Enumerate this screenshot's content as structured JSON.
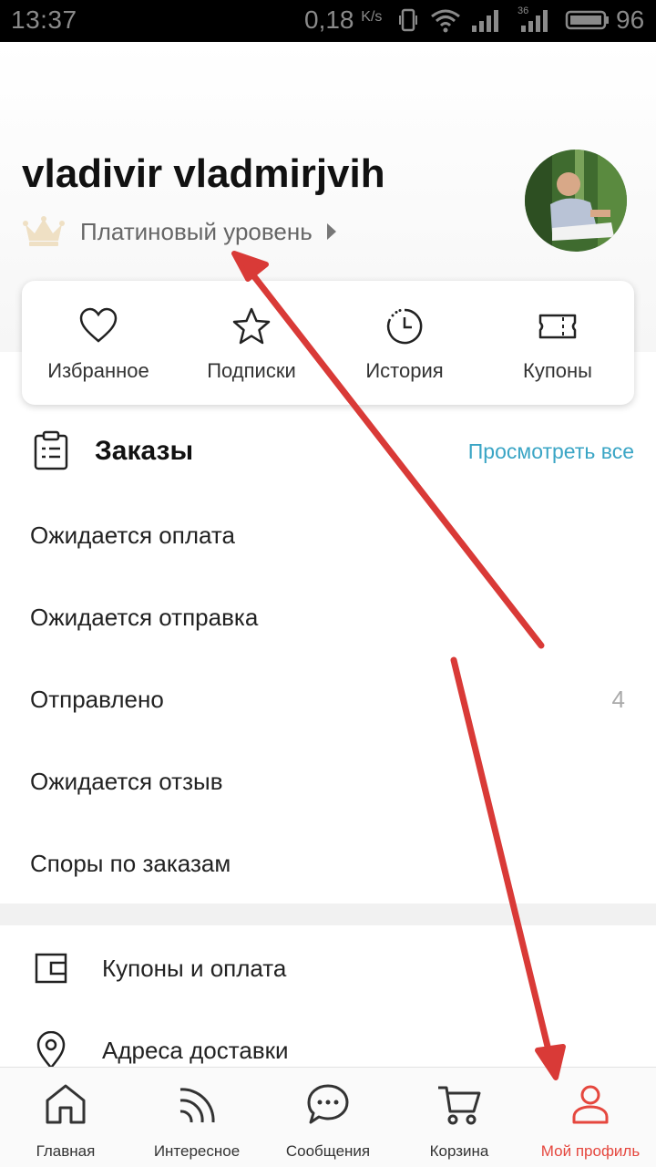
{
  "status_bar": {
    "time": "13:37",
    "speed": "0,18",
    "speed_unit": "K/s",
    "network": "36",
    "battery": "96"
  },
  "profile": {
    "name": "vladivir vladmirjvih",
    "level": "Платиновый уровень"
  },
  "quick_actions": [
    {
      "label": "Избранное",
      "icon": "heart-icon"
    },
    {
      "label": "Подписки",
      "icon": "star-icon"
    },
    {
      "label": "История",
      "icon": "history-icon"
    },
    {
      "label": "Купоны",
      "icon": "coupon-icon"
    }
  ],
  "orders": {
    "title": "Заказы",
    "view_all": "Просмотреть все",
    "items": [
      {
        "label": "Ожидается оплата",
        "count": ""
      },
      {
        "label": "Ожидается отправка",
        "count": ""
      },
      {
        "label": "Отправлено",
        "count": "4"
      },
      {
        "label": "Ожидается отзыв",
        "count": ""
      },
      {
        "label": "Споры по заказам",
        "count": ""
      }
    ]
  },
  "menu": [
    {
      "label": "Купоны и оплата",
      "icon": "wallet-icon"
    },
    {
      "label": "Адреса доставки",
      "icon": "location-pin-icon"
    }
  ],
  "bottom_nav": [
    {
      "label": "Главная",
      "icon": "home-icon"
    },
    {
      "label": "Интересное",
      "icon": "feed-icon"
    },
    {
      "label": "Сообщения",
      "icon": "chat-icon"
    },
    {
      "label": "Корзина",
      "icon": "cart-icon"
    },
    {
      "label": "Мой профиль",
      "icon": "profile-icon",
      "active": true
    }
  ],
  "colors": {
    "accent_link": "#3aa5c5",
    "active_nav": "#e5473e",
    "annotation_arrow": "#d93a37"
  }
}
